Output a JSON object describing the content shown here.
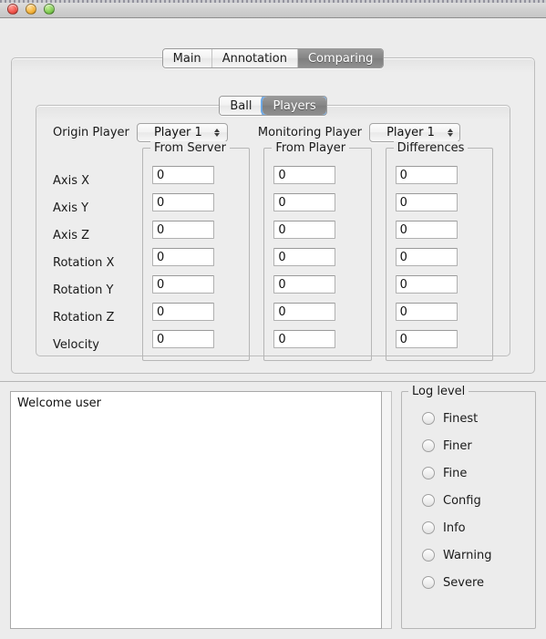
{
  "window": {
    "title": "",
    "controls": [
      "close-button",
      "minimize-button",
      "zoom-button"
    ]
  },
  "main_tabs": {
    "items": [
      {
        "label": "Main",
        "active": false
      },
      {
        "label": "Annotation",
        "active": false
      },
      {
        "label": "Comparing",
        "active": true
      }
    ]
  },
  "sub_tabs": {
    "items": [
      {
        "label": "Ball",
        "active": false
      },
      {
        "label": "Players",
        "active": true
      }
    ]
  },
  "comparing_panel": {
    "origin": {
      "label": "Origin Player",
      "value": "Player 1"
    },
    "monitoring": {
      "label": "Monitoring Player",
      "value": "Player 1"
    },
    "row_labels": [
      "Axis X",
      "Axis Y",
      "Axis Z",
      "Rotation X",
      "Rotation Y",
      "Rotation Z",
      "Velocity"
    ],
    "groups": [
      {
        "legend": "From Server",
        "values": [
          "0",
          "0",
          "0",
          "0",
          "0",
          "0",
          "0"
        ]
      },
      {
        "legend": "From Player",
        "values": [
          "0",
          "0",
          "0",
          "0",
          "0",
          "0",
          "0"
        ]
      },
      {
        "legend": "Differences",
        "values": [
          "0",
          "0",
          "0",
          "0",
          "0",
          "0",
          "0"
        ]
      }
    ]
  },
  "log": {
    "text": "Welcome user"
  },
  "log_level": {
    "legend": "Log level",
    "options": [
      {
        "label": "Finest",
        "selected": false
      },
      {
        "label": "Finer",
        "selected": false
      },
      {
        "label": "Fine",
        "selected": false
      },
      {
        "label": "Config",
        "selected": false
      },
      {
        "label": "Info",
        "selected": false
      },
      {
        "label": "Warning",
        "selected": false
      },
      {
        "label": "Severe",
        "selected": false
      }
    ]
  },
  "colors": {
    "window_bg": "#ececec",
    "panel_bg": "#ededed",
    "field_bg": "#ffffff",
    "active_tab_bg": "#868686",
    "active_tab_fg": "#ffffff",
    "focus_ring": "#5aa0e6",
    "border": "#b6b6b6",
    "text": "#1a1a1a"
  }
}
